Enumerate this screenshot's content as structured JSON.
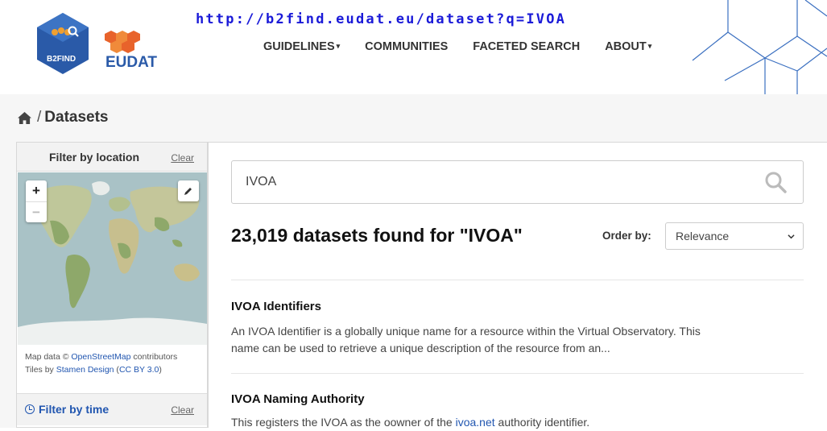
{
  "header": {
    "logo_text": "B2FIND",
    "brand": "EUDAT",
    "url": "http://b2find.eudat.eu/dataset?q=IVOA",
    "nav": [
      {
        "label": "GUIDELINES",
        "has_caret": true
      },
      {
        "label": "COMMUNITIES",
        "has_caret": false
      },
      {
        "label": "FACETED SEARCH",
        "has_caret": false
      },
      {
        "label": "ABOUT",
        "has_caret": true
      }
    ]
  },
  "breadcrumb": {
    "separator": "/",
    "current": "Datasets"
  },
  "sidebar": {
    "location": {
      "title": "Filter by location",
      "clear": "Clear",
      "zoom_in": "+",
      "zoom_out": "−",
      "attribution_line1_prefix": "Map data © ",
      "attribution_line1_link": "OpenStreetMap",
      "attribution_line1_suffix": " contributors",
      "attribution_line2_prefix": "Tiles by ",
      "attribution_line2_link1": "Stamen Design",
      "attribution_line2_mid": " (",
      "attribution_line2_link2": "CC BY 3.0",
      "attribution_line2_suffix": ")"
    },
    "time": {
      "title": "Filter by time",
      "clear": "Clear"
    }
  },
  "search": {
    "query": "IVOA",
    "result_count": "23,019 datasets found for \"IVOA\"",
    "order_label": "Order by:",
    "order_value": "Relevance"
  },
  "results": [
    {
      "title": "IVOA Identifiers",
      "desc_line1": "An IVOA Identifier is a globally unique name for a resource within the Virtual Observatory. This",
      "desc_line2": "name can be used to retrieve a unique description of the resource from an..."
    },
    {
      "title": "IVOA Naming Authority",
      "desc_prefix": "This registers the IVOA as the oowner of the ",
      "desc_link": "ivoa.net",
      "desc_suffix": " authority identifier."
    }
  ],
  "colors": {
    "link": "#2156b0",
    "url": "#1a1ad8",
    "logo_blue": "#2a5aa8",
    "brand_orange": "#e8632b"
  }
}
